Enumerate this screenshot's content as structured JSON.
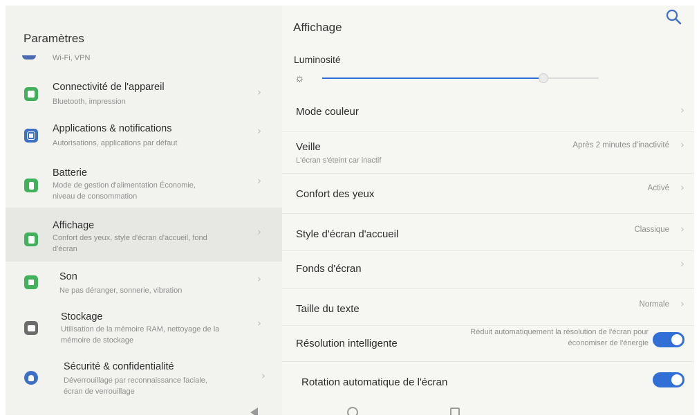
{
  "status_bar": {
    "icons": [
      "photo-icon",
      "square-icon",
      "mail-icon",
      "warning-icon"
    ]
  },
  "left": {
    "title": "Paramètres",
    "wifi_subtitle": "Wi-Fi, VPN",
    "items": [
      {
        "title": "Connectivité de l'appareil",
        "subtitle": "Bluetooth, impression",
        "icon": "device-connectivity-icon",
        "color": "#43b05c"
      },
      {
        "title": "Applications & notifications",
        "subtitle": "Autorisations, applications par défaut",
        "icon": "apps-grid-icon",
        "color": "#3d6fc4"
      },
      {
        "title": "Batterie",
        "subtitle_line1": "Mode de gestion d'alimentation Économie,",
        "subtitle_line2": "niveau de consommation",
        "icon": "battery-icon",
        "color": "#43b05c"
      },
      {
        "title": "Affichage",
        "subtitle_line1": "Confort des yeux, style d'écran d'accueil, fond",
        "subtitle_line2": "d'écran",
        "icon": "display-icon",
        "color": "#43b05c"
      },
      {
        "title": "Son",
        "subtitle": "Ne pas déranger, sonnerie, vibration",
        "icon": "sound-icon",
        "color": "#43b05c"
      },
      {
        "title": "Stockage",
        "subtitle_line1": "Utilisation de la mémoire RAM, nettoyage de la",
        "subtitle_line2": "mémoire de stockage",
        "icon": "storage-icon",
        "color": "#6b6b6b"
      },
      {
        "title": "Sécurité & confidentialité",
        "subtitle_line1": "Déverrouillage par reconnaissance faciale,",
        "subtitle_line2": "écran de verrouillage",
        "icon": "security-icon",
        "color": "#3d6fc4"
      }
    ]
  },
  "right": {
    "title": "Affichage",
    "brightness_label": "Luminosité",
    "brightness_level": 0.8,
    "rows": [
      {
        "label": "Mode couleur"
      },
      {
        "label": "Veille",
        "subtitle": "L'écran s'éteint car inactif",
        "value": "Après 2 minutes d'inactivité"
      },
      {
        "label": "Confort des yeux",
        "value": "Activé"
      },
      {
        "label": "Style d'écran d'accueil",
        "value": "Classique"
      },
      {
        "label": "Fonds d'écran"
      },
      {
        "label": "Taille du texte",
        "value": "Normale"
      },
      {
        "label": "Résolution intelligente",
        "desc_line1": "Réduit automatiquement la résolution de l'écran pour",
        "desc_line2": "économiser de l'énergie",
        "toggle": true
      },
      {
        "label": "Rotation automatique de l'écran",
        "toggle": true
      }
    ]
  },
  "colors": {
    "accent": "#2f6fd6"
  }
}
